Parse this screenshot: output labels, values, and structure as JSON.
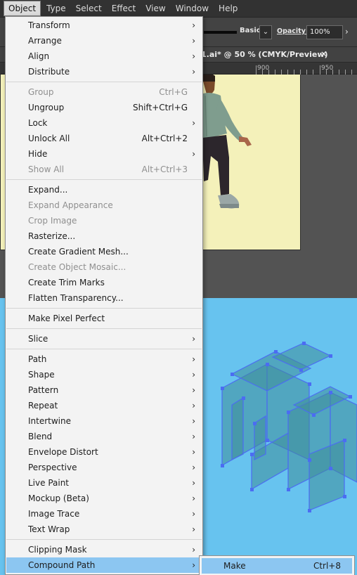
{
  "menubar": {
    "items": [
      "Object",
      "Type",
      "Select",
      "Effect",
      "View",
      "Window",
      "Help"
    ]
  },
  "controlbar": {
    "brush_label": "Basic",
    "opacity_label": "Opacity:",
    "opacity_value": "100%",
    "dropdown_glyph": "⌄",
    "arrow_glyph": "›"
  },
  "document": {
    "tab_title": "1.ai* @ 50 % (CMYK/Preview)",
    "close_glyph": "×"
  },
  "ruler": {
    "labels": [
      "900",
      "950"
    ]
  },
  "object_menu": {
    "arrow_glyph": "›",
    "items": [
      {
        "label": "Transform",
        "submenu": true
      },
      {
        "label": "Arrange",
        "submenu": true
      },
      {
        "label": "Align",
        "submenu": true
      },
      {
        "label": "Distribute",
        "submenu": true
      },
      {
        "label": "Group",
        "shortcut": "Ctrl+G",
        "disabled": true
      },
      {
        "label": "Ungroup",
        "shortcut": "Shift+Ctrl+G"
      },
      {
        "label": "Lock",
        "submenu": true
      },
      {
        "label": "Unlock All",
        "shortcut": "Alt+Ctrl+2"
      },
      {
        "label": "Hide",
        "submenu": true
      },
      {
        "label": "Show All",
        "shortcut": "Alt+Ctrl+3",
        "disabled": true
      },
      {
        "label": "Expand..."
      },
      {
        "label": "Expand Appearance",
        "disabled": true
      },
      {
        "label": "Crop Image",
        "disabled": true
      },
      {
        "label": "Rasterize..."
      },
      {
        "label": "Create Gradient Mesh..."
      },
      {
        "label": "Create Object Mosaic...",
        "disabled": true
      },
      {
        "label": "Create Trim Marks"
      },
      {
        "label": "Flatten Transparency..."
      },
      {
        "label": "Make Pixel Perfect"
      },
      {
        "label": "Slice",
        "submenu": true
      },
      {
        "label": "Path",
        "submenu": true
      },
      {
        "label": "Shape",
        "submenu": true
      },
      {
        "label": "Pattern",
        "submenu": true
      },
      {
        "label": "Repeat",
        "submenu": true
      },
      {
        "label": "Intertwine",
        "submenu": true
      },
      {
        "label": "Blend",
        "submenu": true
      },
      {
        "label": "Envelope Distort",
        "submenu": true
      },
      {
        "label": "Perspective",
        "submenu": true
      },
      {
        "label": "Live Paint",
        "submenu": true
      },
      {
        "label": "Mockup (Beta)",
        "submenu": true
      },
      {
        "label": "Image Trace",
        "submenu": true
      },
      {
        "label": "Text Wrap",
        "submenu": true
      },
      {
        "label": "Clipping Mask",
        "submenu": true
      },
      {
        "label": "Compound Path",
        "submenu": true,
        "highlighted": true
      }
    ]
  },
  "compound_path_submenu": {
    "items": [
      {
        "label": "Make",
        "shortcut": "Ctrl+8"
      }
    ]
  },
  "colors": {
    "menu_highlight": "#8cc6f1",
    "artboard_top": "#f4f1ba",
    "artboard_bottom": "#67c3ef",
    "selection_blue": "#4b6cf2"
  }
}
